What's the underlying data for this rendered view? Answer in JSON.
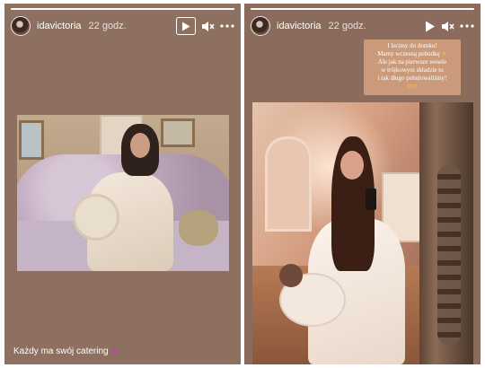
{
  "stories": [
    {
      "username": "idavictoria",
      "time": "22 godz.",
      "progress": 1.0,
      "controls": {
        "play": "play-icon",
        "mute": "speaker-muted-icon",
        "more": "more-icon"
      },
      "caption": "Każdy ma swój catering",
      "caption_emoji": "heart-icon"
    },
    {
      "username": "idavictoria",
      "time": "22 godz.",
      "progress": 1.0,
      "controls": {
        "play": "play-icon",
        "mute": "speaker-muted-icon",
        "more": "more-icon"
      },
      "sticker_lines": [
        "I lecimy do domku!",
        "Mamy wczesną pobudkę",
        "Ale jak na pierwsze wesele",
        "w trójkowym składzie to",
        "i tak długo pobalowaliśmy!"
      ],
      "sticker_emoji_line1": "sun-emoji",
      "sticker_emoji_line2": "party-emoji"
    }
  ],
  "colors": {
    "story_bg": "#8d7060",
    "text": "#ffffff",
    "heart": "#c63fa8"
  }
}
